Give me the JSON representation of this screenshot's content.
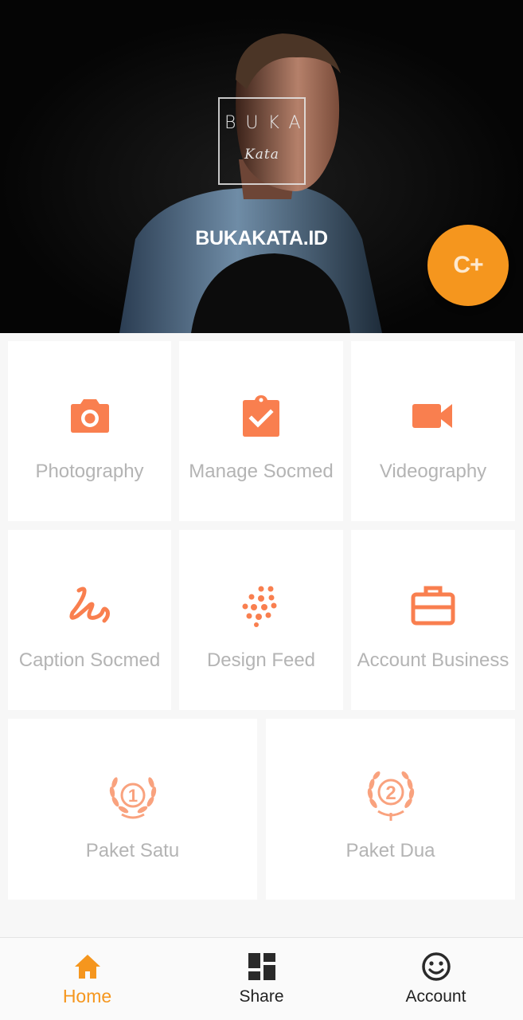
{
  "colors": {
    "accent": "#f5961e",
    "icon": "#f97f4f",
    "tile_label": "#b4b4b4",
    "nav_text": "#222222"
  },
  "header": {
    "logo_text": "BUKA",
    "logo_script": "Kata",
    "brand": "BUKAKATA.ID",
    "fab_label": "C+"
  },
  "services": [
    {
      "label": "Photography",
      "icon": "camera-icon"
    },
    {
      "label": "Manage Socmed",
      "icon": "clipboard-check-icon"
    },
    {
      "label": "Videography",
      "icon": "video-camera-icon"
    },
    {
      "label": "Caption Socmed",
      "icon": "squiggle-icon"
    },
    {
      "label": "Design Feed",
      "icon": "dots-grid-icon"
    },
    {
      "label": "Account Business",
      "icon": "briefcase-icon"
    }
  ],
  "packages": [
    {
      "label": "Paket Satu",
      "number": "1",
      "icon": "laurel-one-icon"
    },
    {
      "label": "Paket Dua",
      "number": "2",
      "icon": "laurel-two-icon"
    }
  ],
  "bottom_nav": [
    {
      "label": "Home",
      "icon": "home-icon",
      "active": true
    },
    {
      "label": "Share",
      "icon": "dashboard-icon",
      "active": false
    },
    {
      "label": "Account",
      "icon": "smiley-icon",
      "active": false
    }
  ]
}
